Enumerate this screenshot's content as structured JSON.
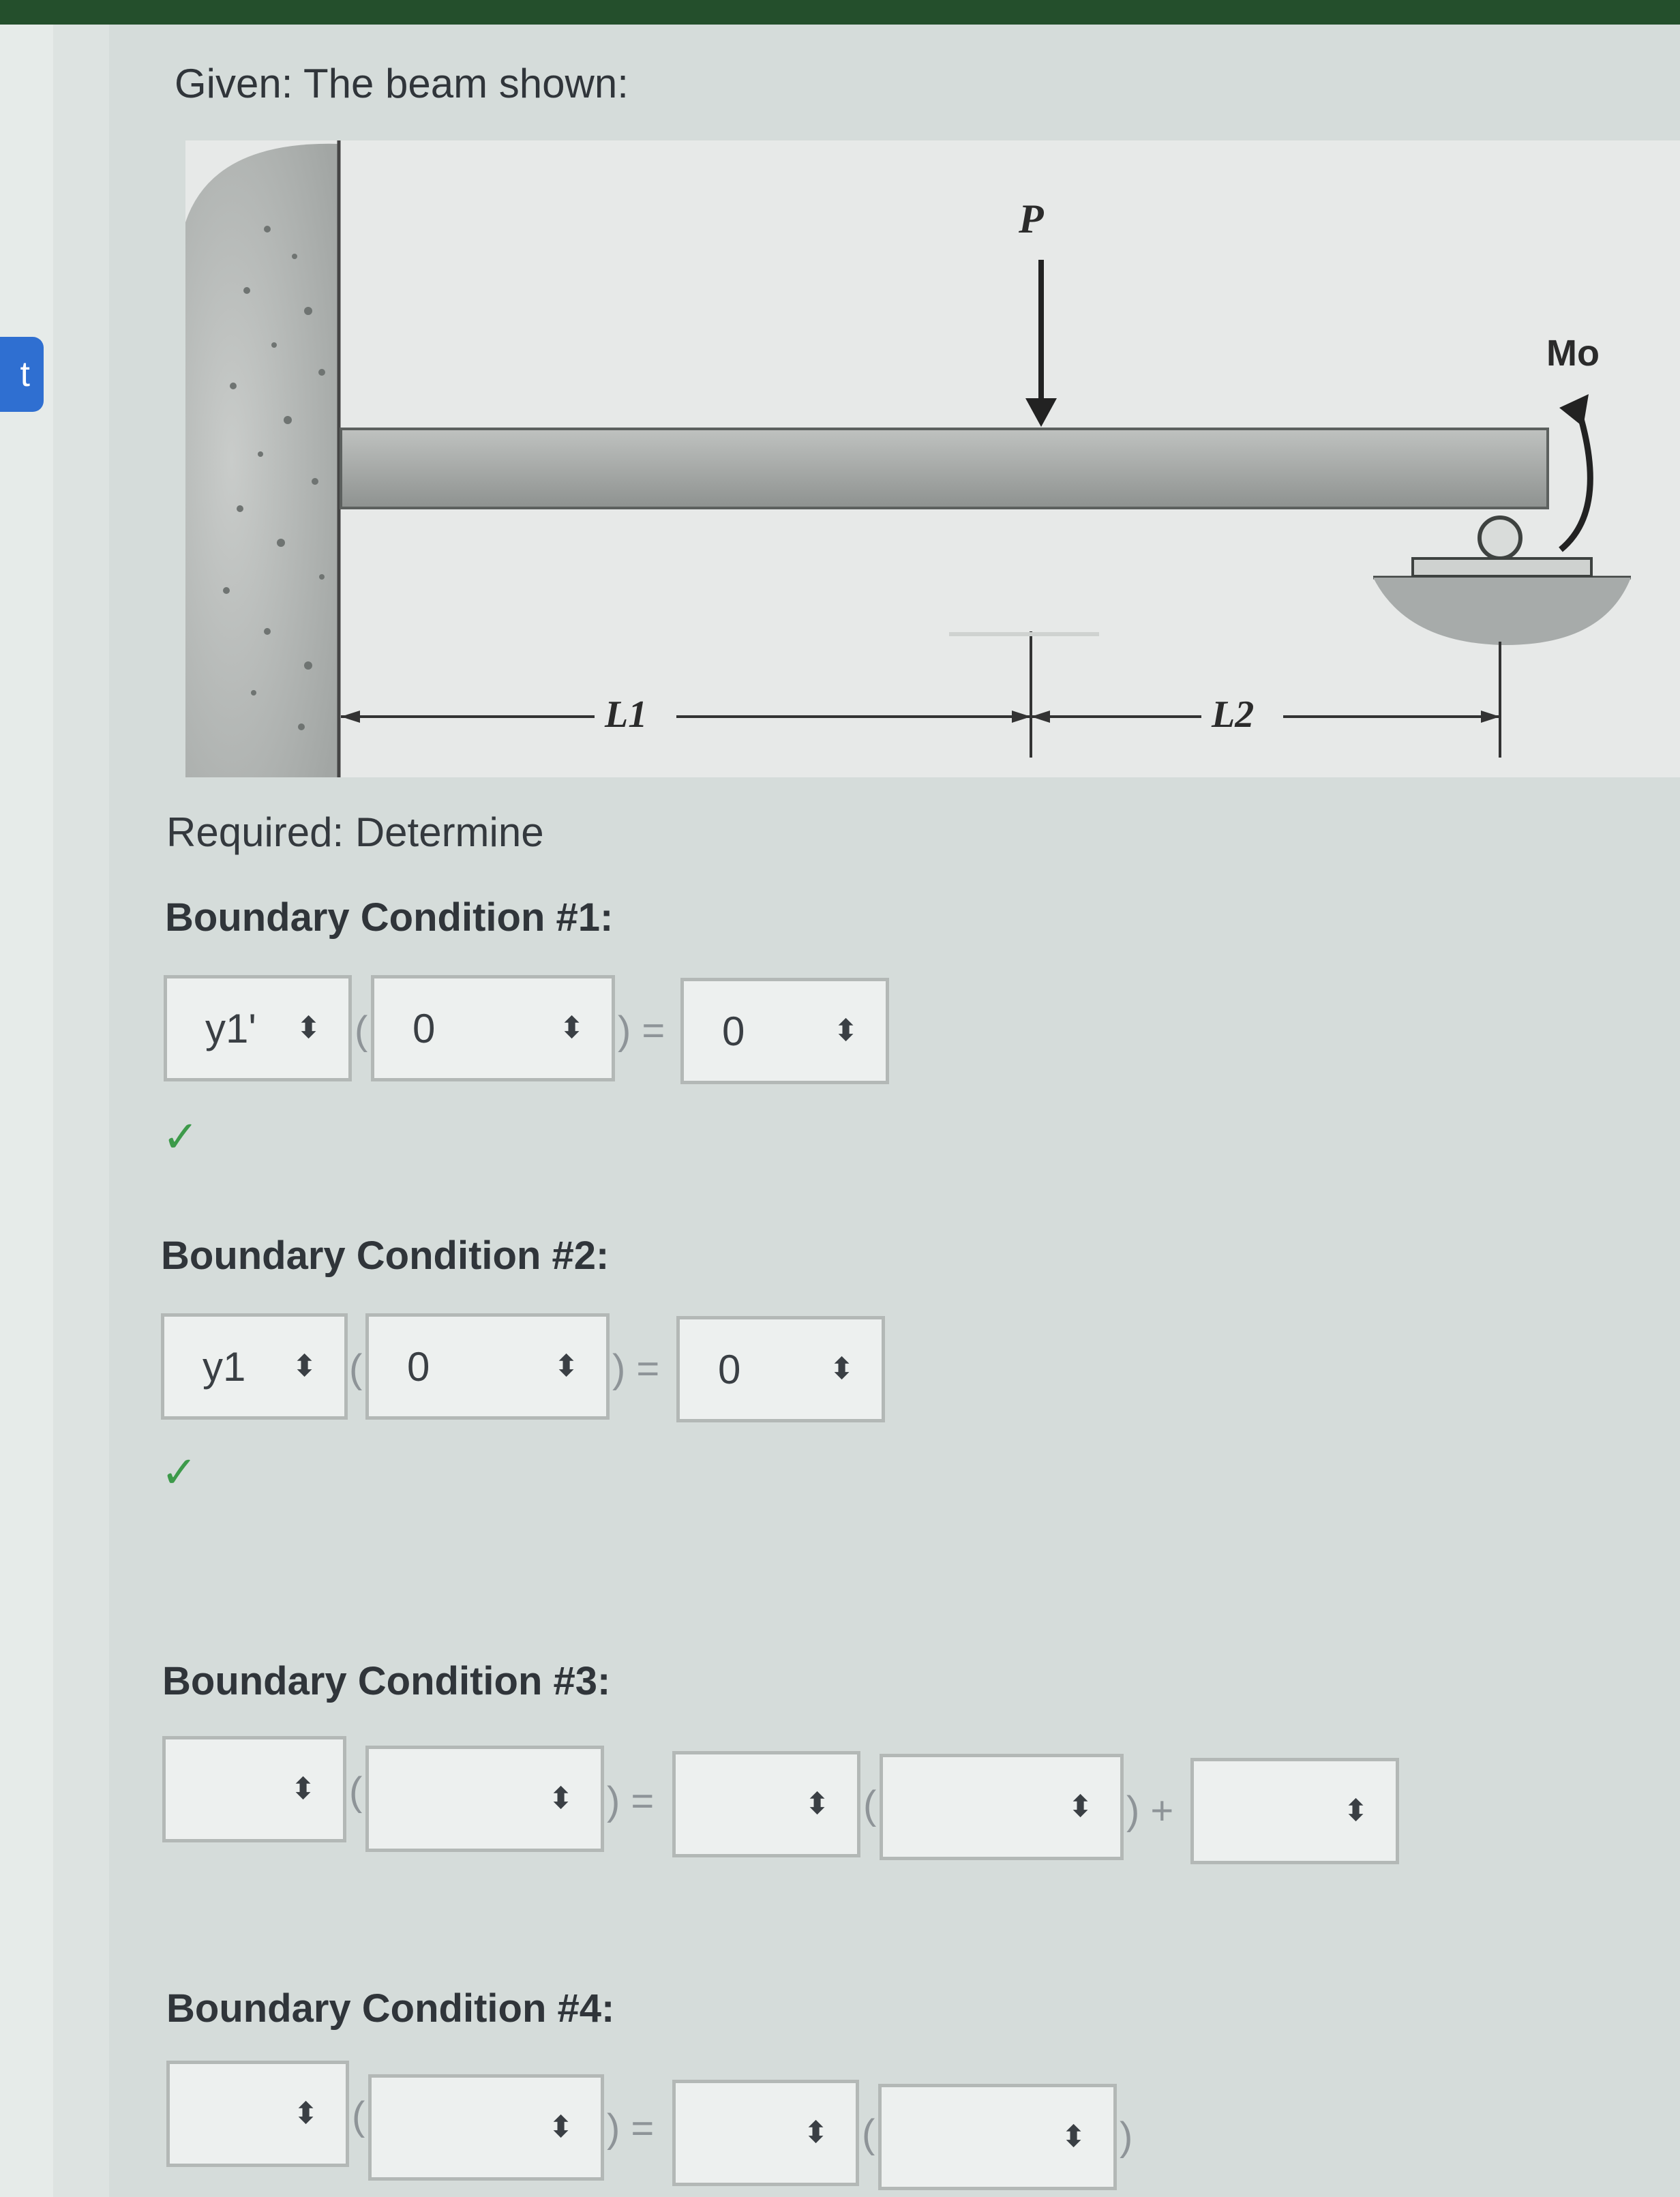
{
  "sidebar": {
    "tab_letter": "t"
  },
  "given_text": "Given: The beam shown:",
  "figure": {
    "load_label": "P",
    "moment_label": "Mo",
    "span1_label": "L1",
    "span2_label": "L2"
  },
  "required_text": "Required: Determine",
  "bc1": {
    "title": "Boundary Condition #1:",
    "func": "y1'",
    "arg": "0",
    "rhs": "0",
    "open_paren": "(",
    "close_eq": ") =",
    "status": "correct",
    "check_icon": "✓"
  },
  "bc2": {
    "title": "Boundary Condition #2:",
    "func": "y1",
    "arg": "0",
    "rhs": "0",
    "open_paren": "(",
    "close_eq": ") =",
    "status": "correct",
    "check_icon": "✓"
  },
  "bc3": {
    "title": "Boundary Condition #3:",
    "func": "",
    "arg": "",
    "rhs_func": "",
    "rhs_arg": "",
    "rhs_const": "",
    "open_paren": "(",
    "close_eq": ") =",
    "open_paren2": "(",
    "close_plus": ") +"
  },
  "bc4": {
    "title": "Boundary Condition #4:",
    "func": "",
    "arg": "",
    "rhs_func": "",
    "rhs_arg": "",
    "open_paren": "(",
    "close_eq": ") =",
    "open_paren2": "(",
    "close_paren": ")"
  },
  "select_arrow_icon": "⬍"
}
